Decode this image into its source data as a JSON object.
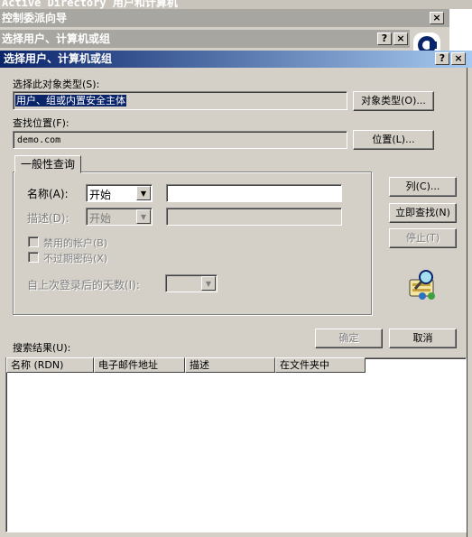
{
  "background": {
    "top_window_title": "Active Directory 用户和计算机",
    "wizard_title": "控制委派向导",
    "mid_title": "选择用户、计算机或组",
    "help_glyph": "?",
    "close_glyph": "×"
  },
  "dialog": {
    "title": "选择用户、计算机或组",
    "help_glyph": "?",
    "close_glyph": "×"
  },
  "object_types": {
    "label": "选择此对象类型(S):",
    "value": "用户、组或内置安全主体",
    "button": "对象类型(O)..."
  },
  "location": {
    "label": "查找位置(F):",
    "value": "demo.com",
    "button": "位置(L)..."
  },
  "query_tab": {
    "label": "一般性查询",
    "name_label": "名称(A):",
    "name_op": "开始",
    "name_value": "",
    "desc_label": "描述(D):",
    "desc_op": "开始",
    "desc_value": "",
    "disabled_accounts": "禁用的帐户(B)",
    "non_expiring": "不过期密码(X)",
    "days_label": "自上次登录后的天数(I):"
  },
  "buttons": {
    "columns": "列(C)...",
    "find_now": "立即查找(N)",
    "stop": "停止(T)",
    "ok": "确定",
    "cancel": "取消"
  },
  "results": {
    "label": "搜索结果(U):",
    "columns": [
      "名称 (RDN)",
      "电子邮件地址",
      "描述",
      "在文件夹中"
    ]
  },
  "icons": {
    "search_icon": "magnifier-users-icon",
    "dropdown_icon": "chevron-down-icon"
  }
}
